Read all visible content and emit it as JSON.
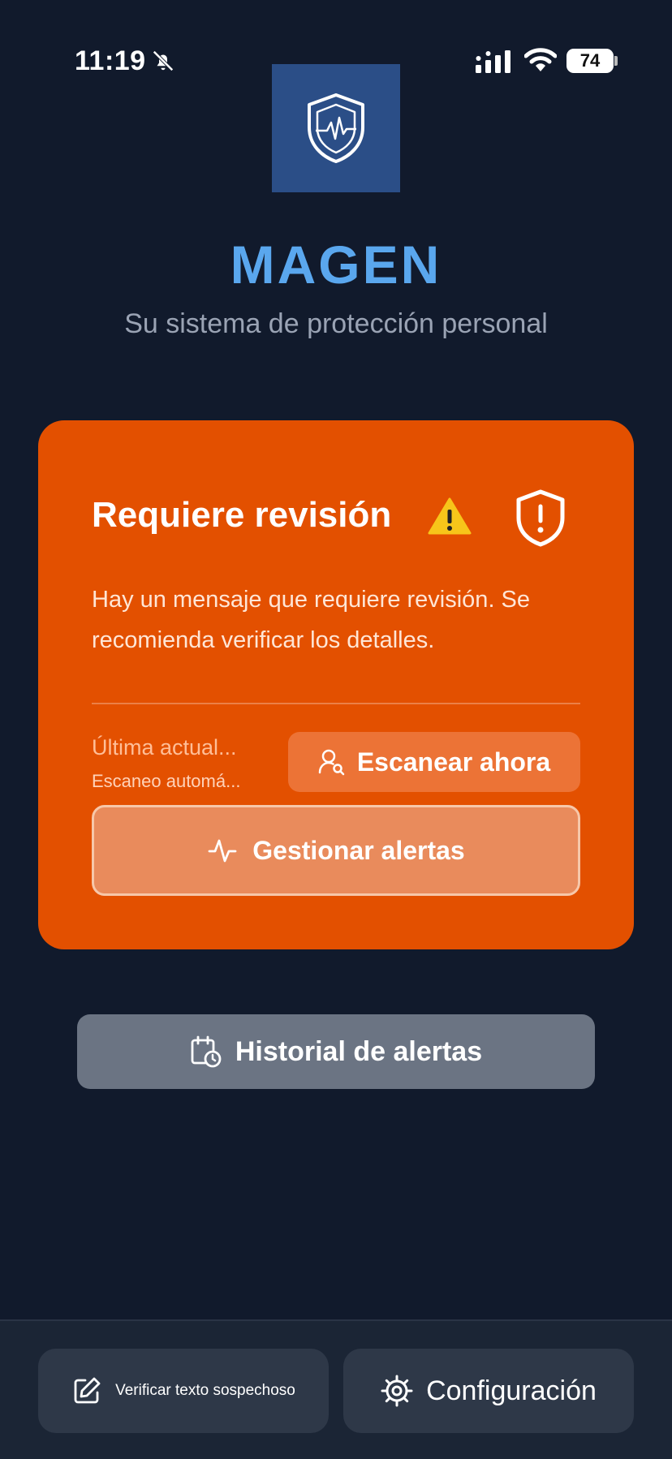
{
  "status_bar": {
    "time": "11:19",
    "battery": "74"
  },
  "header": {
    "title": "MAGEN",
    "subtitle": "Su sistema de protección personal"
  },
  "alert_card": {
    "title": "Requiere revisión",
    "message": "Hay un mensaje que requiere revisión. Se recomienda verificar los detalles.",
    "last_update": "Última actual...",
    "auto_scan": "Escaneo automá...",
    "scan_button": "Escanear ahora",
    "manage_button": "Gestionar alertas"
  },
  "history_button": "Historial de alertas",
  "bottom_bar": {
    "verify_button": "Verificar texto sospechoso",
    "config_button": "Configuración"
  },
  "colors": {
    "background": "#111a2c",
    "accent_title": "#5aa7ee",
    "card": "#e35000",
    "logo_box": "#2b4e87"
  },
  "icons": [
    "bell-muted-icon",
    "signal-icon",
    "wifi-icon",
    "shield-pulse-icon",
    "warning-icon",
    "shield-alert-icon",
    "user-search-icon",
    "activity-icon",
    "calendar-clock-icon",
    "edit-icon",
    "gear-icon"
  ]
}
